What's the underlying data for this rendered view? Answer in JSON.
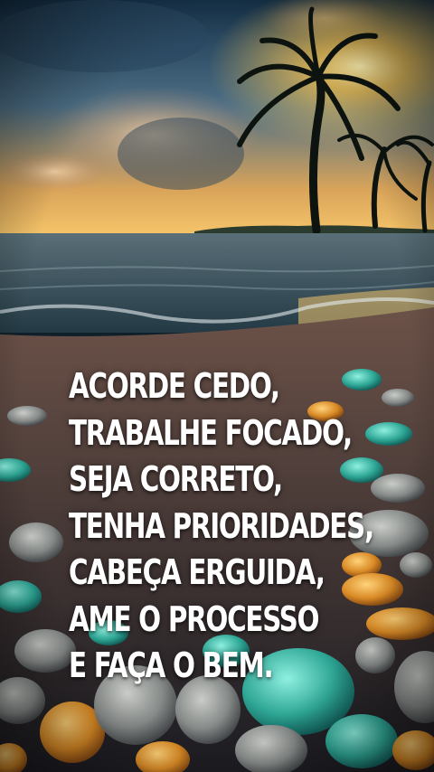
{
  "quote": {
    "lines": [
      "ACORDE CEDO,",
      "TRABALHE FOCADO,",
      "SEJA CORRETO,",
      "TENHA PRIORIDADES,",
      "CABEÇA ERGUIDA,",
      "AME O PROCESSO",
      "E FAÇA O BEM."
    ]
  },
  "colors": {
    "text": "#ffffff",
    "sky_top": "#1d3b52",
    "sunset": "#f3b340",
    "sea": "#38515a",
    "pebble_teal": "#3fb5a3",
    "pebble_amber": "#e39a2f"
  }
}
